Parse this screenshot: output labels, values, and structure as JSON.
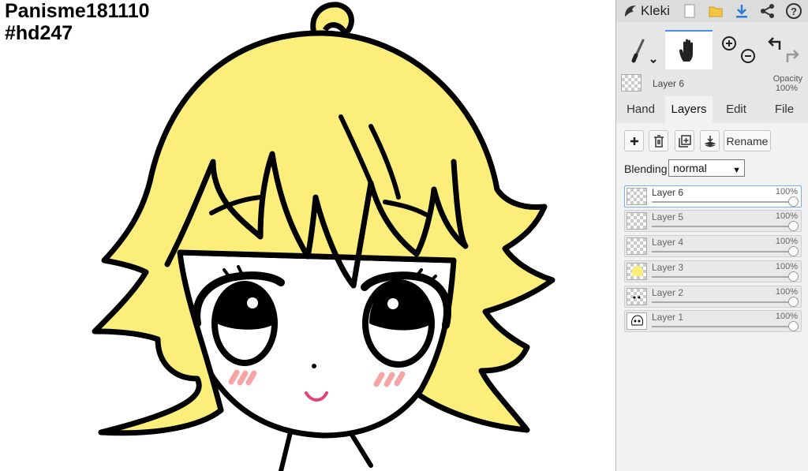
{
  "canvas": {
    "caption_line1": "Panisme181110",
    "caption_line2": "#hd247",
    "colors": {
      "hair": "#fcee7a",
      "outline": "#000000",
      "blush": "#f5a5a5",
      "mouth": "#e0457a"
    }
  },
  "app": {
    "name": "Kleki"
  },
  "toolbar_icons": [
    "new-file-icon",
    "open-folder-icon",
    "download-icon",
    "share-icon",
    "help-icon"
  ],
  "tools": {
    "brush": "brush-icon",
    "hand": "hand-icon",
    "zoom_in": "zoom-in-icon",
    "zoom_out": "zoom-out-icon",
    "undo": "undo-icon",
    "redo": "redo-icon"
  },
  "current_layer": {
    "name": "Layer 6",
    "opacity_label": "Opacity",
    "opacity_value": "100%"
  },
  "tabs": [
    {
      "label": "Hand",
      "active": false
    },
    {
      "label": "Layers",
      "active": true
    },
    {
      "label": "Edit",
      "active": false
    },
    {
      "label": "File",
      "active": false
    }
  ],
  "layer_actions": {
    "rename_label": "Rename"
  },
  "blending": {
    "label": "Blending",
    "value": "normal"
  },
  "layers": [
    {
      "name": "Layer 6",
      "opacity": "100%",
      "selected": true
    },
    {
      "name": "Layer 5",
      "opacity": "100%",
      "selected": false
    },
    {
      "name": "Layer 4",
      "opacity": "100%",
      "selected": false
    },
    {
      "name": "Layer 3",
      "opacity": "100%",
      "selected": false
    },
    {
      "name": "Layer 2",
      "opacity": "100%",
      "selected": false
    },
    {
      "name": "Layer 1",
      "opacity": "100%",
      "selected": false
    }
  ],
  "accent_color": "#4a90e2"
}
